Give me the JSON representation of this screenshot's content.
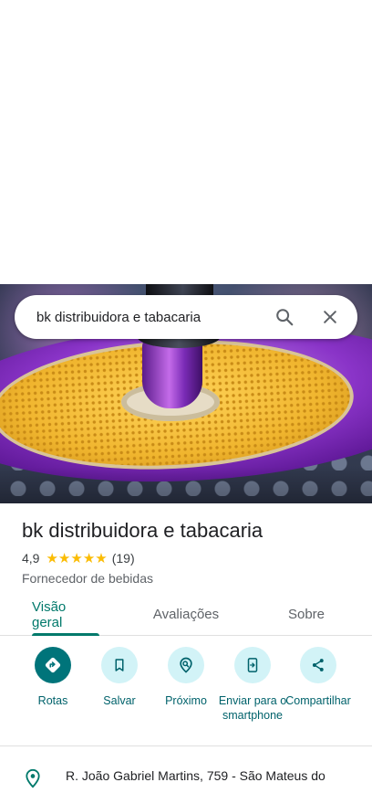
{
  "search": {
    "query": "bk distribuidora e tabacaria"
  },
  "place": {
    "name": "bk distribuidora e tabacaria",
    "rating": "4,9",
    "stars": 5,
    "review_count": "(19)",
    "category": "Fornecedor de bebidas"
  },
  "tabs": [
    {
      "label": "Visão geral",
      "active": true
    },
    {
      "label": "Avaliações",
      "active": false
    },
    {
      "label": "Sobre",
      "active": false
    }
  ],
  "actions": [
    {
      "label": "Rotas",
      "icon": "directions-icon"
    },
    {
      "label": "Salvar",
      "icon": "bookmark-icon"
    },
    {
      "label": "Próximo",
      "icon": "nearby-icon"
    },
    {
      "label": "Enviar para o smartphone",
      "icon": "send-to-phone-icon"
    },
    {
      "label": "Compartilhar",
      "icon": "share-icon"
    }
  ],
  "address": {
    "text": "R. João Gabriel Martins, 759 - São Mateus do"
  },
  "colors": {
    "accent": "#00796b",
    "action_bg": "#d2f3f7",
    "primary_action": "#00747a",
    "star": "#fbbc04"
  }
}
